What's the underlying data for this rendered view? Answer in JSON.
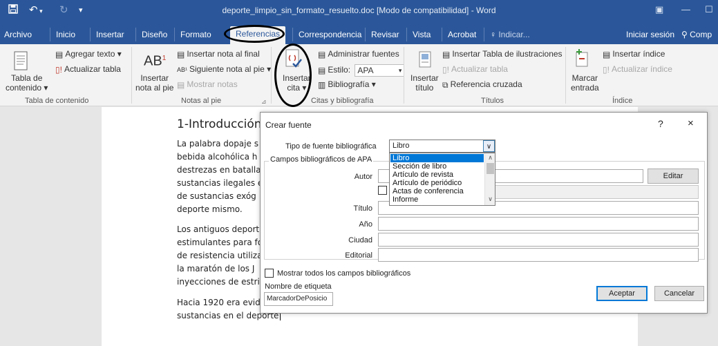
{
  "titlebar": {
    "doc_title": "deporte_limpio_sin_formato_resuelto.doc [Modo de compatibilidad] - Word",
    "save_icon": "save-icon",
    "undo_icon": "undo-icon",
    "redo_icon": "redo-icon"
  },
  "tabs": {
    "archivo": "Archivo",
    "inicio": "Inicio",
    "insertar": "Insertar",
    "diseno": "Diseño",
    "formato": "Formato",
    "referencias": "Referencias",
    "correspondencia": "Correspondencia",
    "revisar": "Revisar",
    "vista": "Vista",
    "acrobat": "Acrobat",
    "indicar": "Indicar...",
    "iniciar_sesion": "Iniciar sesión",
    "compartir": "Comp"
  },
  "ribbon": {
    "tabla_contenido_1": "Tabla de",
    "tabla_contenido_2": "contenido",
    "agregar_texto": "Agregar texto",
    "actualizar_tabla": "Actualizar tabla",
    "grp_tabla": "Tabla de contenido",
    "insertar_nota_1": "Insertar",
    "insertar_nota_2": "nota al pie",
    "insertar_nota_final": "Insertar nota al final",
    "siguiente_nota": "Siguiente nota al pie",
    "mostrar_notas": "Mostrar notas",
    "grp_notas": "Notas al pie",
    "insertar_cita_1": "Insertar",
    "insertar_cita_2": "cita",
    "administrar_fuentes": "Administrar fuentes",
    "estilo_label": "Estilo:",
    "estilo_value": "APA",
    "bibliografia": "Bibliografía",
    "grp_citas": "Citas y bibliografía",
    "insertar_titulo_1": "Insertar",
    "insertar_titulo_2": "título",
    "insertar_tabla_ilustraciones": "Insertar Tabla de ilustraciones",
    "actualizar_tabla_2": "Actualizar tabla",
    "referencia_cruzada": "Referencia cruzada",
    "grp_titulos": "Títulos",
    "marcar_entrada_1": "Marcar",
    "marcar_entrada_2": "entrada",
    "insertar_indice": "Insertar índice",
    "actualizar_indice": "Actualizar índice",
    "grp_indice": "Índice"
  },
  "document": {
    "heading": "1-Introducción",
    "para1": [
      "La palabra dopaje s",
      "bebida alcohólica h",
      "destrezas en batalla",
      "sustancias ilegales e",
      "de sustancias exóg",
      "deporte mismo."
    ],
    "para2": [
      "Los antiguos deport",
      "estimulantes para fo",
      "de resistencia utiliza",
      "la maratón de los J",
      "inyecciones de estric"
    ],
    "para3": [
      "Hacia 1920 era evid",
      "sustancias en el deporte"
    ]
  },
  "dialog": {
    "title": "Crear fuente",
    "help": "?",
    "close": "×",
    "tipo_label": "Tipo de fuente bibliográfica",
    "tipo_value": "Libro",
    "campos_label": "Campos bibliográficos de APA",
    "options": [
      "Libro",
      "Sección de libro",
      "Artículo de revista",
      "Artículo de periódico",
      "Actas de conferencia",
      "Informe"
    ],
    "autor_label": "Autor",
    "editar_button": "Editar",
    "titulo_label": "Título",
    "ano_label": "Año",
    "ciudad_label": "Ciudad",
    "editorial_label": "Editorial",
    "mostrar_todos": "Mostrar todos los campos bibliográficos",
    "nombre_etiqueta_label": "Nombre de etiqueta",
    "nombre_etiqueta_value": "MarcadorDePosicio",
    "aceptar": "Aceptar",
    "cancelar": "Cancelar"
  },
  "colors": {
    "word_blue": "#2b579a",
    "ribbon_bg": "#f3f3f3",
    "selection_blue": "#0078d7"
  }
}
